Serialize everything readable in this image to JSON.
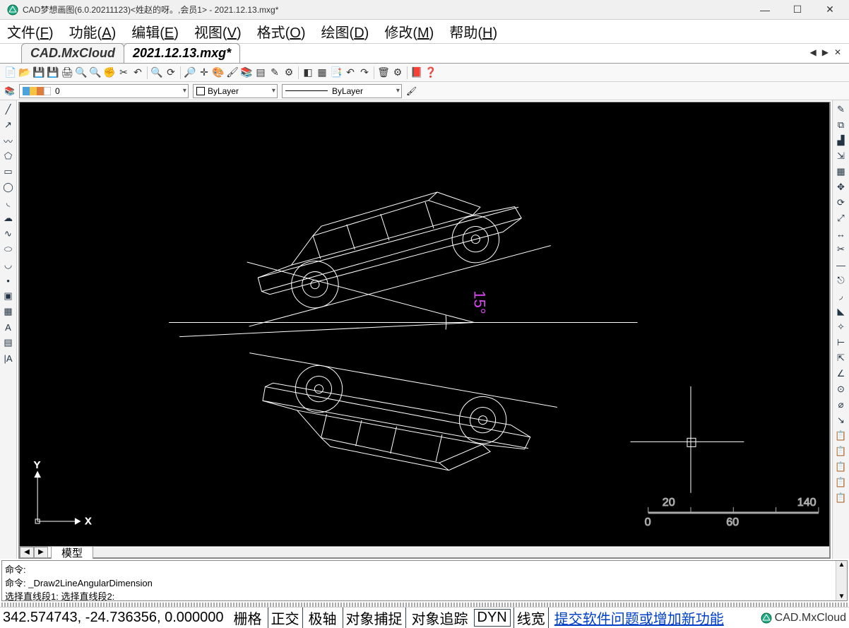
{
  "window": {
    "title": "CAD梦想画图(6.0.20211123)<姓赵的呀。,会员1> - 2021.12.13.mxg*"
  },
  "menu": {
    "file": "文件(F)",
    "func": "功能(A)",
    "edit": "编辑(E)",
    "view": "视图(V)",
    "format": "格式(O)",
    "draw": "绘图(D)",
    "modify": "修改(M)",
    "help": "帮助(H)"
  },
  "tabs": {
    "t1": "CAD.MxCloud",
    "t2": "2021.12.13.mxg*"
  },
  "layer": {
    "current": "0"
  },
  "colorStyle": {
    "label": "ByLayer"
  },
  "linetype": {
    "label": "ByLayer"
  },
  "modelTab": "模型",
  "drawing": {
    "angleLabel": "15°",
    "ruler": {
      "t20": "20",
      "t140": "140",
      "t0": "0",
      "t60": "60"
    }
  },
  "ucs": {
    "x": "X",
    "y": "Y"
  },
  "cmd": {
    "line1": "命令:",
    "line2": "命令: _Draw2LineAngularDimension",
    "line3": "选择直线段1: 选择直线段2:"
  },
  "status": {
    "coords": "342.574743, -24.736356,  0.000000",
    "grid": "栅格",
    "ortho": "正交",
    "polar": "极轴",
    "osnap": "对象捕捉",
    "otrack": "对象追踪",
    "dyn": "DYN",
    "lwt": "线宽",
    "feedback": "提交软件问题或增加新功能",
    "brand": "CAD.MxCloud"
  }
}
